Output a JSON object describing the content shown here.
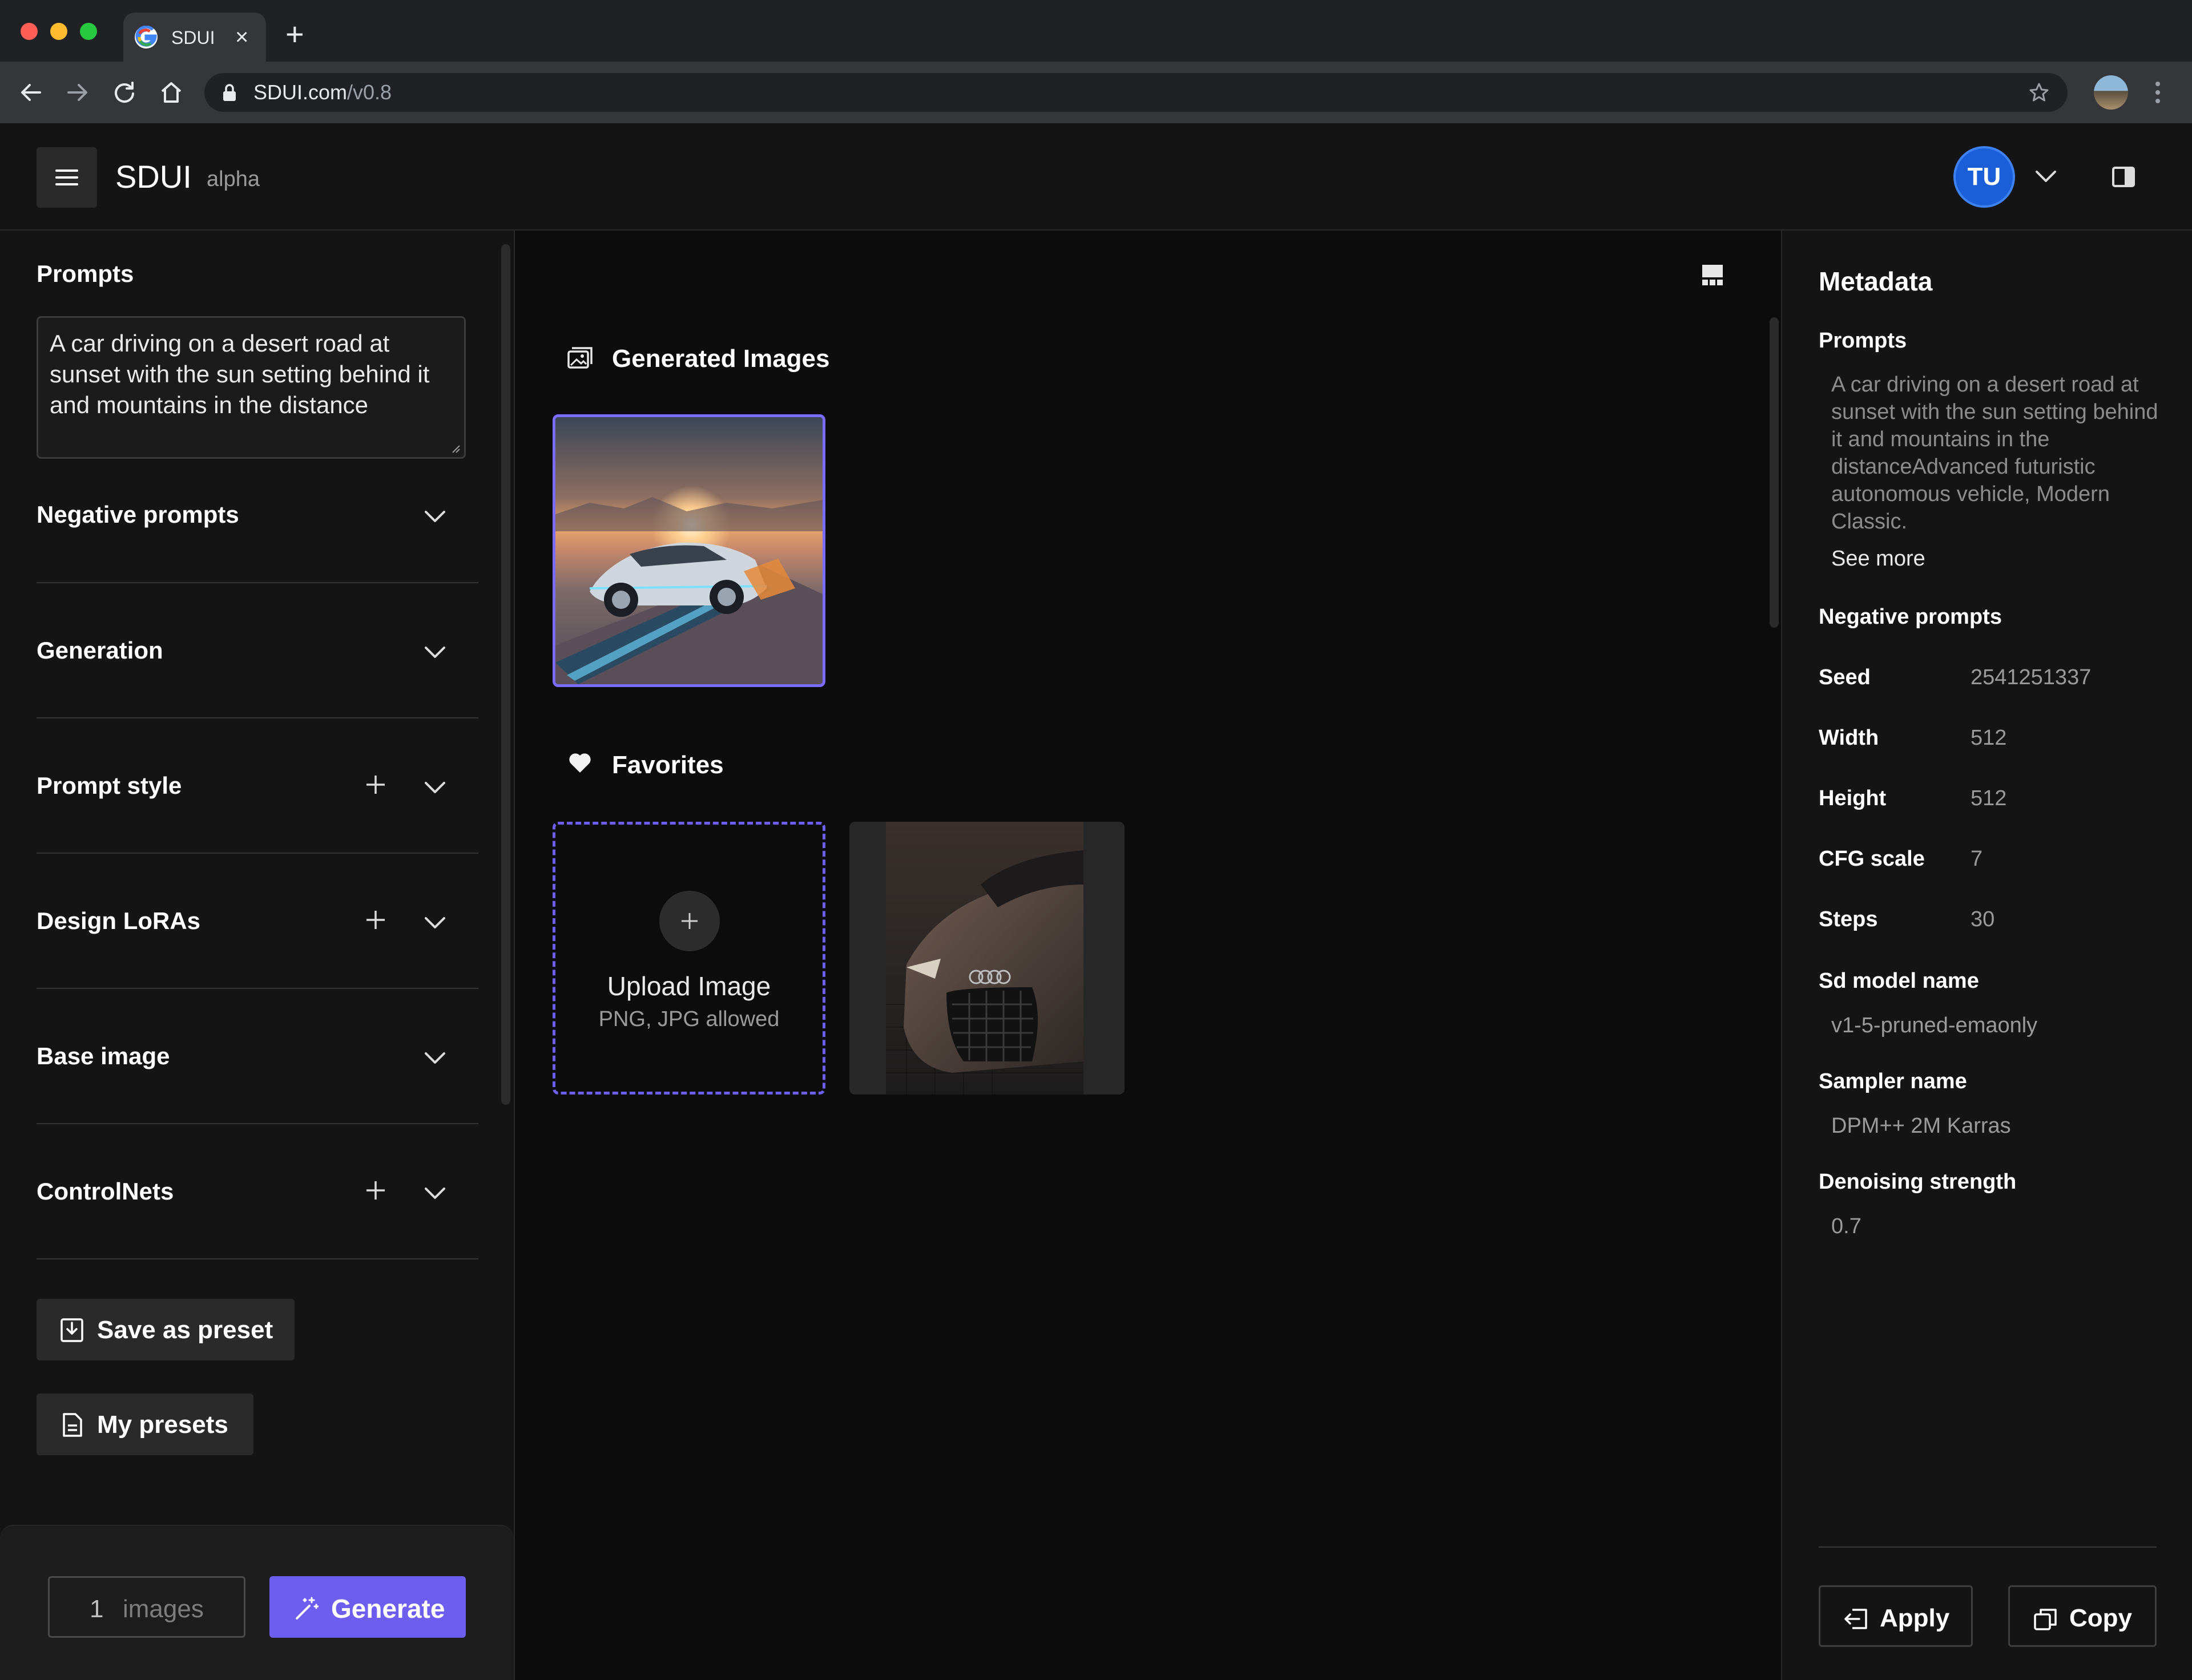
{
  "browser": {
    "tab_title": "SDUI",
    "url_host": "SDUI.com",
    "url_path": "/v0.8"
  },
  "header": {
    "app_name": "SDUI",
    "badge": "alpha",
    "user_initials": "TU"
  },
  "sidebar": {
    "prompts_heading": "Prompts",
    "prompt_text": "A car driving on a desert road at sunset with the sun setting behind it and mountains in the distance",
    "sections": [
      {
        "label": "Negative prompts",
        "has_add": false
      },
      {
        "label": "Generation",
        "has_add": false
      },
      {
        "label": "Prompt style",
        "has_add": true
      },
      {
        "label": "Design LoRAs",
        "has_add": true
      },
      {
        "label": "Base image",
        "has_add": false
      },
      {
        "label": "ControlNets",
        "has_add": true
      }
    ],
    "save_preset_label": "Save as preset",
    "my_presets_label": "My presets",
    "image_count": "1",
    "image_count_unit": "images",
    "generate_label": "Generate"
  },
  "main": {
    "generated_heading": "Generated Images",
    "favorites_heading": "Favorites",
    "upload_title": "Upload Image",
    "upload_hint": "PNG, JPG allowed"
  },
  "metadata": {
    "title": "Metadata",
    "prompts_label": "Prompts",
    "prompt_text": "A car driving on a desert road at sunset with the sun setting behind it and mountains in the distanceAdvanced futuristic autonomous vehicle, Modern Classic.",
    "see_more": "See more",
    "negative_prompts_label": "Negative prompts",
    "fields": [
      {
        "label": "Seed",
        "value": "2541251337"
      },
      {
        "label": "Width",
        "value": "512"
      },
      {
        "label": "Height",
        "value": "512"
      },
      {
        "label": "CFG scale",
        "value": "7"
      },
      {
        "label": "Steps",
        "value": "30"
      }
    ],
    "sd_model_label": "Sd model name",
    "sd_model_value": "v1-5-pruned-emaonly",
    "sampler_label": "Sampler name",
    "sampler_value": "DPM++ 2M Karras",
    "denoising_label": "Denoising strength",
    "denoising_value": "0.7",
    "apply_label": "Apply",
    "copy_label": "Copy"
  },
  "colors": {
    "accent": "#6d5ef0",
    "avatar": "#1a5fd8",
    "background": "#141414",
    "canvas": "#0c0c0c"
  }
}
